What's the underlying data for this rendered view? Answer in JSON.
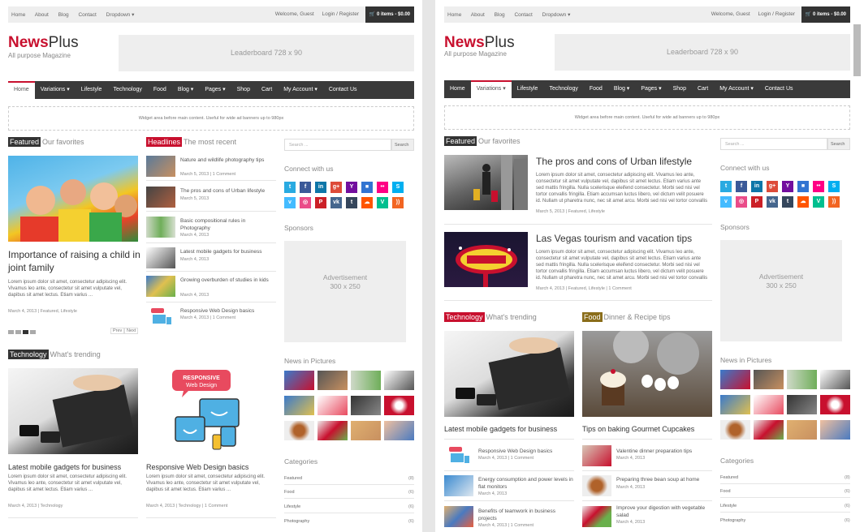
{
  "topbar": {
    "links": [
      "Home",
      "About",
      "Blog",
      "Contact",
      "Dropdown ▾"
    ],
    "welcome": "Welcome, Guest",
    "login": "Login / Register",
    "cart": "0 items - $0.00"
  },
  "logo": {
    "name_bold": "News",
    "name_light": "Plus",
    "tagline": "All purpose Magazine"
  },
  "leaderboard": "Leaderboard 728 x 90",
  "nav_items": [
    "Home",
    "Variations ▾",
    "Lifestyle",
    "Technology",
    "Food",
    "Blog ▾",
    "Pages ▾",
    "Shop",
    "Cart",
    "My Account ▾",
    "Contact Us"
  ],
  "widget_text": "Widget area before main content. Useful for wide ad banners up to 980px",
  "sidebar": {
    "search_placeholder": "Search ...",
    "search_button": "Search",
    "connect_title": "Connect with us",
    "sponsors_title": "Sponsors",
    "ad_line1": "Advertisement",
    "ad_line2": "300 x 250",
    "pictures_title": "News in Pictures",
    "categories_title": "Categories",
    "categories": [
      {
        "name": "Featured",
        "count": "(8)"
      },
      {
        "name": "Food",
        "count": "(6)"
      },
      {
        "name": "Lifestyle",
        "count": "(6)"
      },
      {
        "name": "Photography",
        "count": "(6)"
      }
    ]
  },
  "left": {
    "featured": {
      "label": "Featured",
      "sub": "Our favorites"
    },
    "headlines": {
      "label": "Headlines",
      "sub": "The most recent"
    },
    "main_title": "Importance of raising a child in joint family",
    "main_excerpt": "Lorem ipsum dolor sit amet, consectetur adipiscing elit. Vivamus leo ante, consectetur sit amet vulputate vel, dapibus sit amet lectus. Etiam varius ...",
    "main_meta": "March 4, 2013  |  Featured, Lifestyle",
    "slider_prev": "Prev",
    "slider_next": "Next",
    "headline_items": [
      {
        "title": "Nature and wildlife photography tips",
        "meta": "March 5, 2013  |  1 Comment"
      },
      {
        "title": "The pros and cons of Urban lifestyle",
        "meta": "March 5, 2013"
      },
      {
        "title": "Basic compositional rules in Photography",
        "meta": "March 4, 2013"
      },
      {
        "title": "Latest mobile gadgets for business",
        "meta": "March 4, 2013"
      },
      {
        "title": "Growing overburden of studies in kids",
        "meta": "March 4, 2013"
      },
      {
        "title": "Responsive Web Design basics",
        "meta": "March 4, 2013  |  1 Comment"
      }
    ],
    "technology": {
      "label": "Technology",
      "sub": "What's trending"
    },
    "tech_posts": [
      {
        "title": "Latest mobile gadgets for business",
        "meta": "March 4, 2013  |  Technology"
      },
      {
        "title": "Responsive Web Design basics",
        "meta": "March 4, 2013  |  Technology  |  1 Comment"
      }
    ],
    "tech_excerpt": "Lorem ipsum dolor sit amet, consectetur adipiscing elit. Vivamus leo ante, consectetur sit amet vulputate vel, dapibus sit amet lectus. Etiam varius ...",
    "responsive_badge_line1": "RESPONSIVE",
    "responsive_badge_line2": "Web Design"
  },
  "right": {
    "featured": {
      "label": "Featured",
      "sub": "Our favorites"
    },
    "posts": [
      {
        "title": "The pros and cons of Urban lifestyle",
        "meta": "March 5, 2013  |  Featured, Lifestyle"
      },
      {
        "title": "Las Vegas tourism and vacation tips",
        "meta": "March 4, 2013  |  Featured, Lifestyle  |  1 Comment"
      }
    ],
    "excerpt": "Lorem ipsum dolor sit amet, consectetur adipiscing elit. Vivamus leo ante, consectetur sit amet vulputate vel, dapibus sit amet lectus. Etiam varius ante sed mattis fringilla. Nulla scelerisque eleifend consectetur. Morbi sed nisi vel tortor convallis fringilla. Etiam accumsan luctus libero, vel dictum velit posuere id. Nullam ut pharetra nunc, nec sit amet arcu. Morbi sed nisi vel tortor convallis nulla ...",
    "technology": {
      "label": "Technology",
      "sub": "What's trending"
    },
    "food": {
      "label": "Food",
      "sub": "Dinner & Recipe tips"
    },
    "tech_main": "Latest mobile gadgets for business",
    "food_main": "Tips on baking Gourmet Cupcakes",
    "tech_list": [
      {
        "title": "Responsive Web Design basics",
        "meta": "March 4, 2013  |  1 Comment"
      },
      {
        "title": "Energy consumption and power levels in flat monitors",
        "meta": "March 4, 2013"
      },
      {
        "title": "Benefits of teamwork in business projects",
        "meta": "March 4, 2013  |  1 Comment"
      }
    ],
    "food_list": [
      {
        "title": "Valentine dinner preparation tips",
        "meta": "March 4, 2013"
      },
      {
        "title": "Preparing three bean soup at home",
        "meta": "March 4, 2013"
      },
      {
        "title": "Improve your digestion with vegetable salad",
        "meta": "March 4, 2013"
      }
    ]
  },
  "colors": {
    "accent": "#c8102e",
    "nav": "#3a3a3a",
    "technology": "#c8102e",
    "food": "#8a6d1a"
  },
  "social_icons": [
    {
      "name": "twitter-icon",
      "glyph": "t",
      "color": "#29aae1"
    },
    {
      "name": "facebook-icon",
      "glyph": "f",
      "color": "#3b5998"
    },
    {
      "name": "linkedin-icon",
      "glyph": "in",
      "color": "#0e76a8"
    },
    {
      "name": "googleplus-icon",
      "glyph": "g+",
      "color": "#dd4b39"
    },
    {
      "name": "yahoo-icon",
      "glyph": "Y",
      "color": "#720e9e"
    },
    {
      "name": "delicious-icon",
      "glyph": "■",
      "color": "#3274d1"
    },
    {
      "name": "flickr-icon",
      "glyph": "••",
      "color": "#ff0084"
    },
    {
      "name": "skype-icon",
      "glyph": "S",
      "color": "#00aff0"
    },
    {
      "name": "vimeo-icon",
      "glyph": "v",
      "color": "#44bbff"
    },
    {
      "name": "dribbble-icon",
      "glyph": "◎",
      "color": "#ea4c89"
    },
    {
      "name": "pinterest-icon",
      "glyph": "P",
      "color": "#cb2027"
    },
    {
      "name": "vk-icon",
      "glyph": "vk",
      "color": "#45668e"
    },
    {
      "name": "tumblr-icon",
      "glyph": "t",
      "color": "#35465c"
    },
    {
      "name": "soundcloud-icon",
      "glyph": "☁",
      "color": "#ff5500"
    },
    {
      "name": "vine-icon",
      "glyph": "V",
      "color": "#00bf8f"
    },
    {
      "name": "rss-icon",
      "glyph": "))",
      "color": "#f26522"
    }
  ]
}
